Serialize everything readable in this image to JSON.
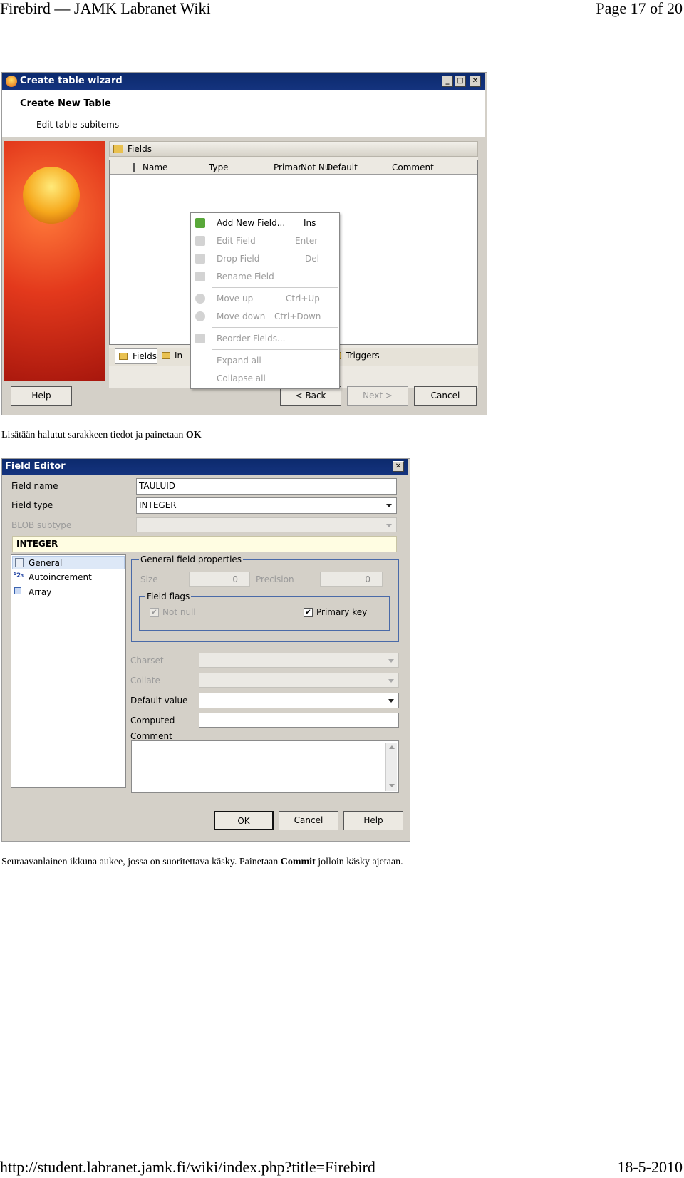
{
  "page_header": {
    "title": "Firebird — JAMK Labranet Wiki",
    "page": "Page 17 of 20"
  },
  "page_footer": {
    "url": "http://student.labranet.jamk.fi/wiki/index.php?title=Firebird",
    "date": "18-5-2010"
  },
  "para1": {
    "text": "Lisätään halutut sarakkeen tiedot ja painetaan ",
    "bold": "OK"
  },
  "para2": {
    "text": "Seuraavanlainen ikkuna aukee, jossa on suoritettava käsky. Painetaan ",
    "bold": "Commit",
    "after": " jolloin käsky ajetaan."
  },
  "wizard": {
    "title": "Create table wizard",
    "heading": "Create New Table",
    "subheading": "Edit table subitems",
    "panel_title": "Fields",
    "columns": [
      "Name",
      "Type",
      "Primar",
      "Not Nu",
      "Default",
      "Comment"
    ],
    "tabs": {
      "fields": "Fields",
      "indices": "In",
      "triggers": "Triggers"
    },
    "context_menu": [
      {
        "label": "Add New Field...",
        "shortcut": "Ins",
        "enabled": true
      },
      {
        "label": "Edit Field",
        "shortcut": "Enter",
        "enabled": false
      },
      {
        "label": "Drop Field",
        "shortcut": "Del",
        "enabled": false
      },
      {
        "label": "Rename Field",
        "shortcut": "",
        "enabled": false
      },
      {
        "label": "Move up",
        "shortcut": "Ctrl+Up",
        "enabled": false
      },
      {
        "label": "Move down",
        "shortcut": "Ctrl+Down",
        "enabled": false
      },
      {
        "label": "Reorder Fields...",
        "shortcut": "",
        "enabled": false
      },
      {
        "label": "Expand all",
        "shortcut": "",
        "enabled": false
      },
      {
        "label": "Collapse all",
        "shortcut": "",
        "enabled": false
      }
    ],
    "buttons": {
      "help": "Help",
      "back": "< Back",
      "next": "Next >",
      "cancel": "Cancel"
    },
    "sysbuttons": {
      "min": "_",
      "max": "□",
      "close": "✕"
    }
  },
  "field_editor": {
    "title": "Field Editor",
    "close": "✕",
    "field_name_label": "Field name",
    "field_name_value": "TAULUID",
    "field_type_label": "Field type",
    "field_type_value": "INTEGER",
    "blob_subtype_label": "BLOB subtype",
    "type_banner": "INTEGER",
    "nav_items": [
      "General",
      "Autoincrement",
      "Array"
    ],
    "group_general": "General field properties",
    "size_label": "Size",
    "size_value": "0",
    "precision_label": "Precision",
    "precision_value": "0",
    "group_flags": "Field flags",
    "not_null_label": "Not null",
    "not_null_checked": true,
    "primary_key_label": "Primary key",
    "primary_key_checked": true,
    "charset_label": "Charset",
    "collate_label": "Collate",
    "default_label": "Default value",
    "computed_label": "Computed",
    "comment_label": "Comment",
    "buttons": {
      "ok": "OK",
      "cancel": "Cancel",
      "help": "Help"
    },
    "checkmark": "✔"
  }
}
